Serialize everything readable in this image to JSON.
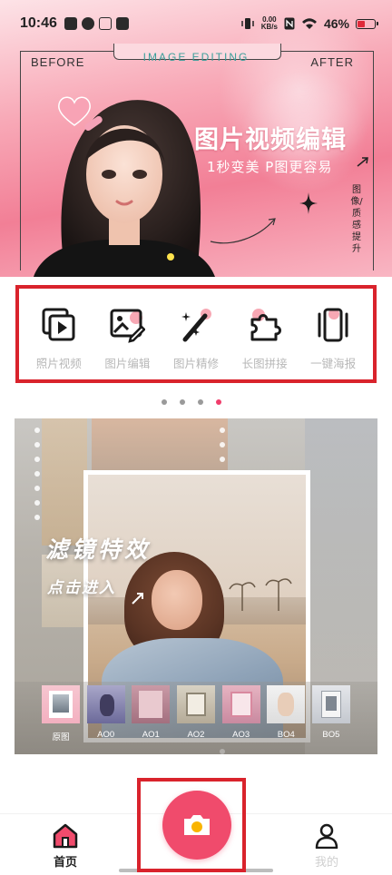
{
  "status_bar": {
    "time": "10:46",
    "net_speed_value": "0.00",
    "net_speed_unit": "KB/s",
    "battery": "46%",
    "battery_level": 0.46
  },
  "banner": {
    "before_label": "BEFORE",
    "after_label": "AFTER",
    "editing_label": "IMAGE EDITING",
    "title": "图片视频编辑",
    "subtitle": "1秒变美 P图更容易",
    "vertical_text": "图像/质感提升"
  },
  "tools": [
    {
      "label": "照片视频",
      "icon": "photo-video-icon"
    },
    {
      "label": "图片编辑",
      "icon": "image-edit-icon"
    },
    {
      "label": "图片精修",
      "icon": "magic-wand-icon"
    },
    {
      "label": "长图拼接",
      "icon": "puzzle-icon"
    },
    {
      "label": "一键海报",
      "icon": "poster-icon"
    }
  ],
  "pager": {
    "count": 4,
    "active_index": 3
  },
  "filter_card": {
    "title": "滤镜特效",
    "subtitle": "点击进入",
    "thumbnails": [
      {
        "label": "原图"
      },
      {
        "label": "AO0"
      },
      {
        "label": "AO1"
      },
      {
        "label": "AO2"
      },
      {
        "label": "AO3"
      },
      {
        "label": "BO4"
      },
      {
        "label": "BO5"
      }
    ]
  },
  "bottom_nav": {
    "home_label": "首页",
    "mine_label": "我的",
    "camera_icon": "camera-icon"
  },
  "colors": {
    "accent": "#f04b6c",
    "highlight_border": "#d9232c",
    "pager_active": "#f03d6b",
    "pager_inactive": "#9a9a9a",
    "tool_label": "#b8b8b8"
  }
}
